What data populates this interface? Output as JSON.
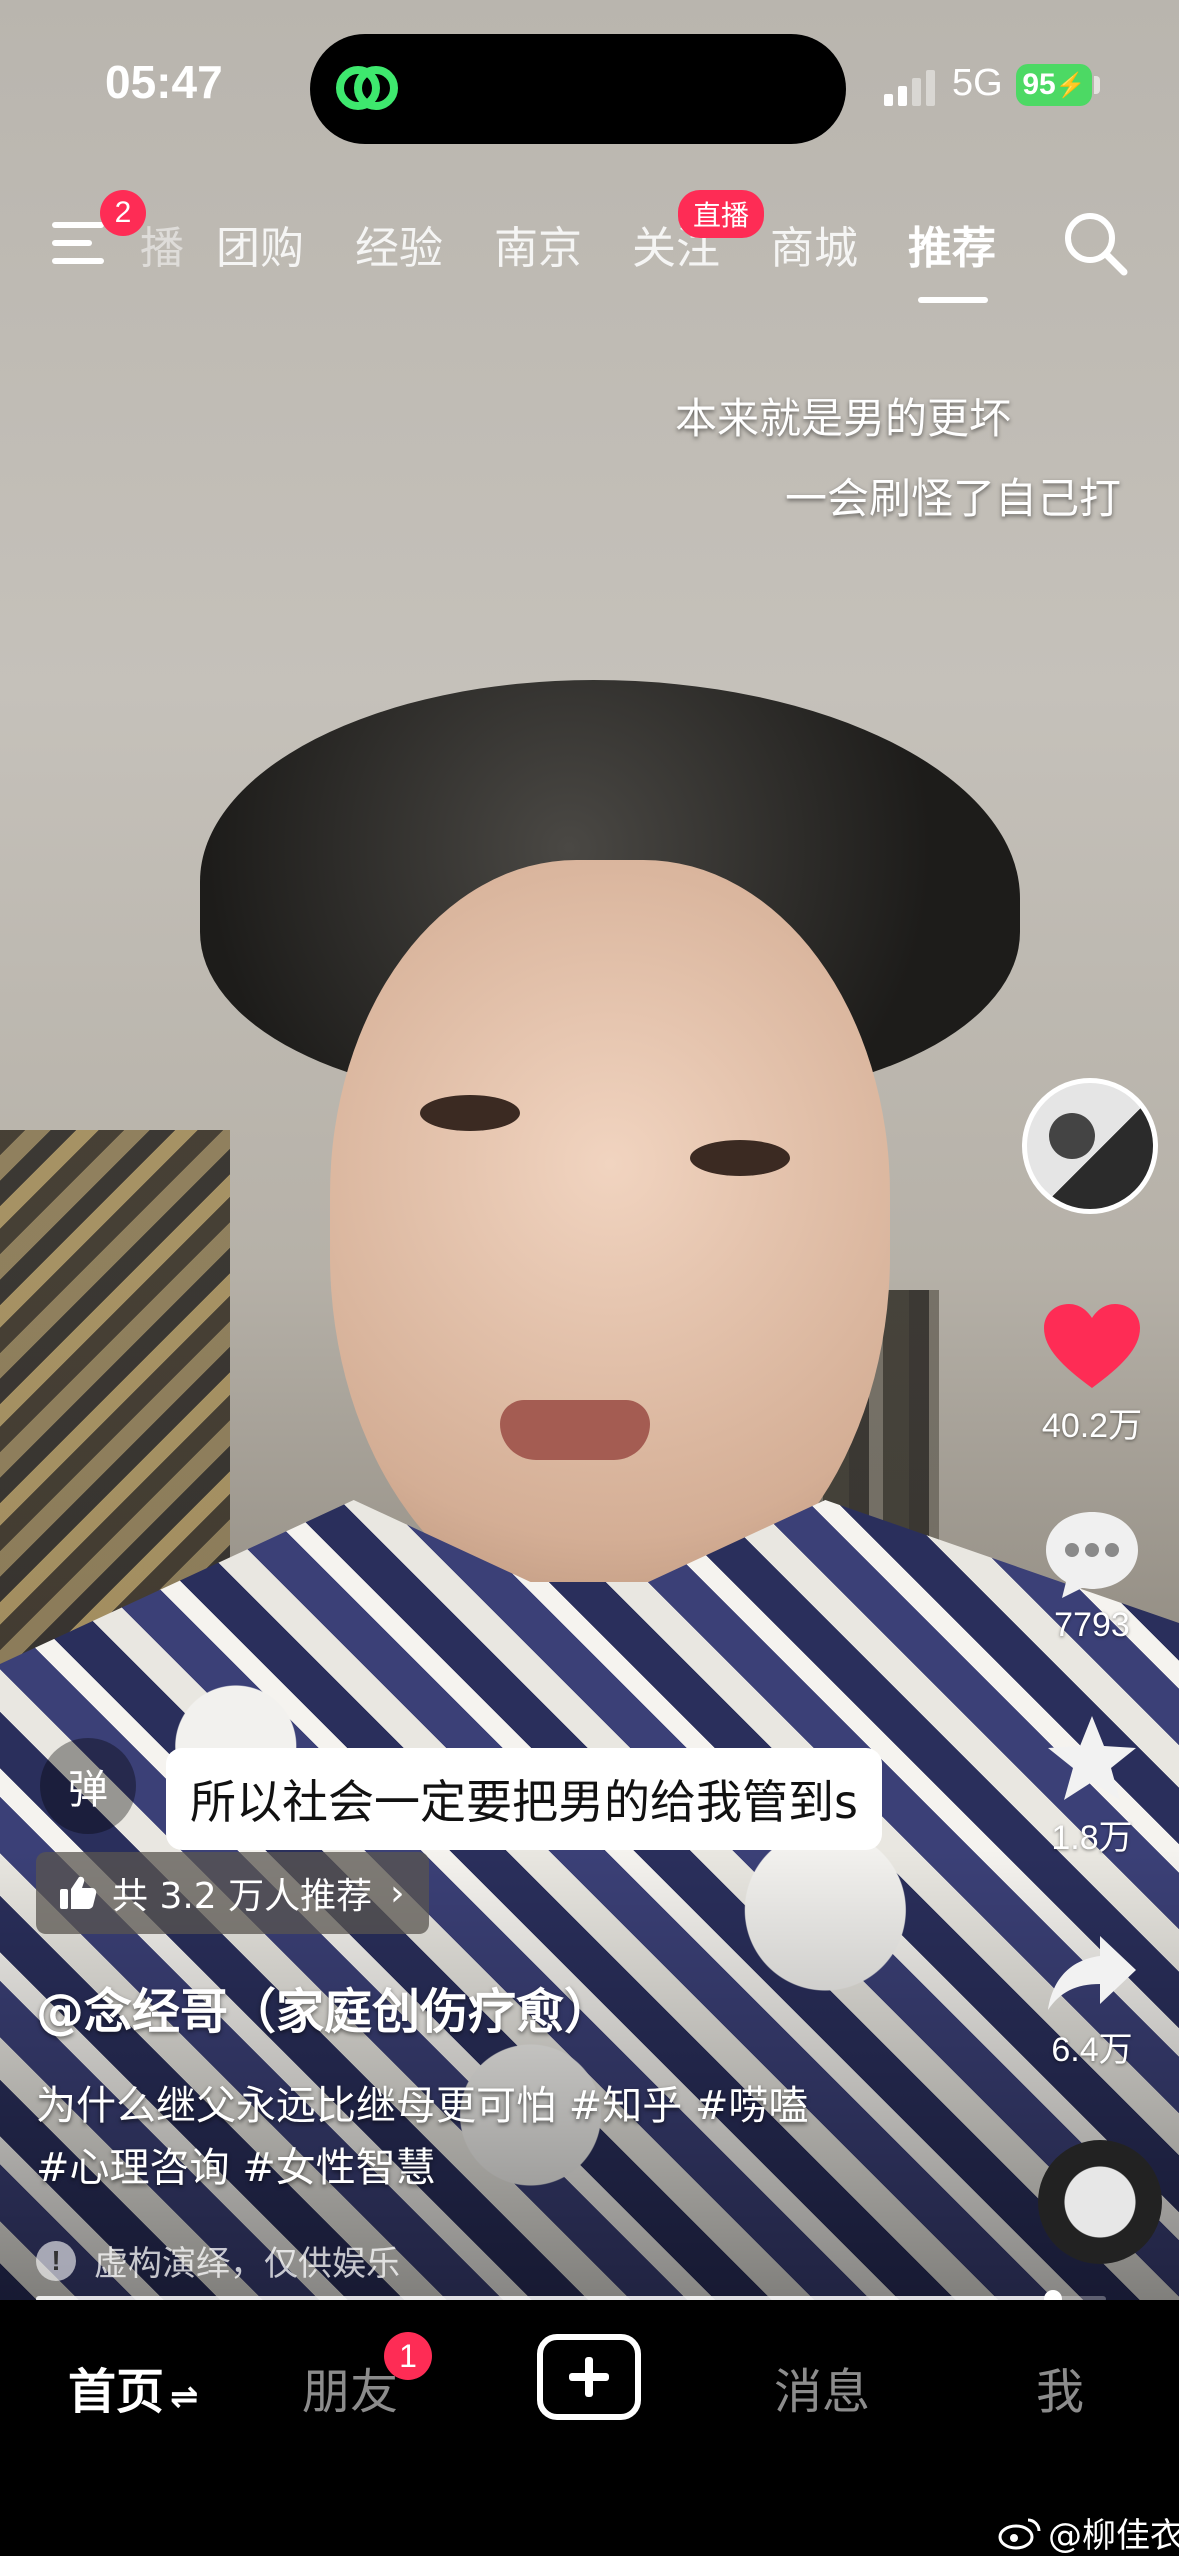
{
  "status_bar": {
    "time": "05:47",
    "network": "5G",
    "battery": "95"
  },
  "top_nav": {
    "menu_badge": "2",
    "tabs": [
      {
        "label": "播"
      },
      {
        "label": "团购"
      },
      {
        "label": "经验"
      },
      {
        "label": "南京"
      },
      {
        "label": "关注"
      },
      {
        "label": "商城"
      },
      {
        "label": "推荐"
      }
    ],
    "live_badge": "直播",
    "active_tab": "推荐"
  },
  "video": {
    "overlay_lines": [
      "本来就是男的更坏",
      "一会刷怪了自己打"
    ],
    "subtitle": "所以社会一定要把男的给我管到s",
    "danmaku_label": "弹",
    "recommend_text": "共 3.2 万人推荐",
    "author": "@念经哥（家庭创伤疗愈）",
    "description_line1": "为什么继父永远比继母更可怕 #知乎 #唠嗑",
    "description_line2": "#心理咨询 #女性智慧",
    "disclaimer": "虚构演绎，仅供娱乐",
    "progress": 0.95
  },
  "actions": {
    "likes": "40.2万",
    "comments": "7793",
    "favorites": "1.8万",
    "shares": "6.4万"
  },
  "bottom_nav": {
    "home": "首页",
    "friends": "朋友",
    "friends_badge": "1",
    "messages": "消息",
    "me": "我"
  },
  "watermark": "@柳佳衣",
  "colors": {
    "accent": "#fe2c55",
    "battery": "#4cd964",
    "like": "#fe2c55"
  }
}
